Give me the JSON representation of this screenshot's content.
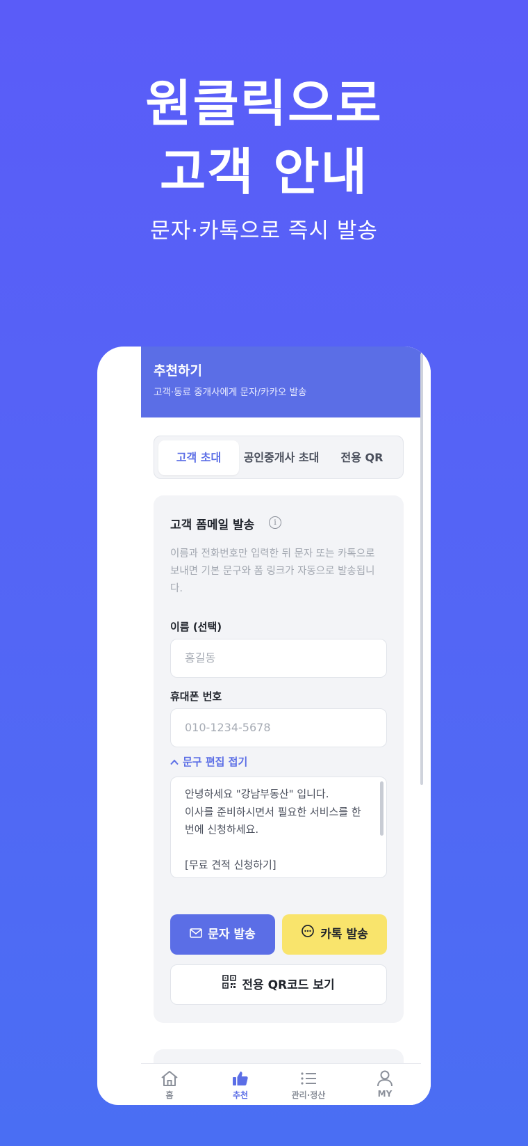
{
  "hero": {
    "title_line1": "원클릭으로",
    "title_line2": "고객 안내",
    "subtitle": "문자·카톡으로 즉시 발송"
  },
  "app_header": {
    "title": "추천하기",
    "subtitle": "고객·동료 중개사에게 문자/카카오 발송"
  },
  "tabs": [
    {
      "label": "고객 초대",
      "active": true
    },
    {
      "label": "공인중개사 초대",
      "active": false
    },
    {
      "label": "전용 QR",
      "active": false
    }
  ],
  "form_card": {
    "title": "고객 폼메일 발송",
    "info_icon": "info-icon",
    "description": "이름과 전화번호만 입력한 뒤 문자 또는 카톡으로 보내면 기본 문구와 폼 링크가 자동으로 발송됩니다.",
    "name_label": "이름 (선택)",
    "name_placeholder": "홍길동",
    "phone_label": "휴대폰 번호",
    "phone_placeholder": "010-1234-5678",
    "toggle_label": "문구 편집 접기",
    "message_text": "안녕하세요 \"강남부동산\" 입니다.\n이사를 준비하시면서 필요한 서비스를 한번에 신청하세요.\n\n[무료 견적 신청하기]",
    "sms_button": "문자 발송",
    "kakao_button": "카톡 발송",
    "qr_button": "전용 QR코드 보기"
  },
  "bottom_nav": [
    {
      "label": "홈",
      "icon": "home-icon",
      "active": false
    },
    {
      "label": "추천",
      "icon": "thumbs-up-icon",
      "active": true
    },
    {
      "label": "관리·정산",
      "icon": "list-icon",
      "active": false
    },
    {
      "label": "MY",
      "icon": "user-icon",
      "active": false
    }
  ],
  "colors": {
    "brand": "#5b6ee6",
    "kakao": "#f9e46c",
    "background": "#5a5cf8"
  }
}
